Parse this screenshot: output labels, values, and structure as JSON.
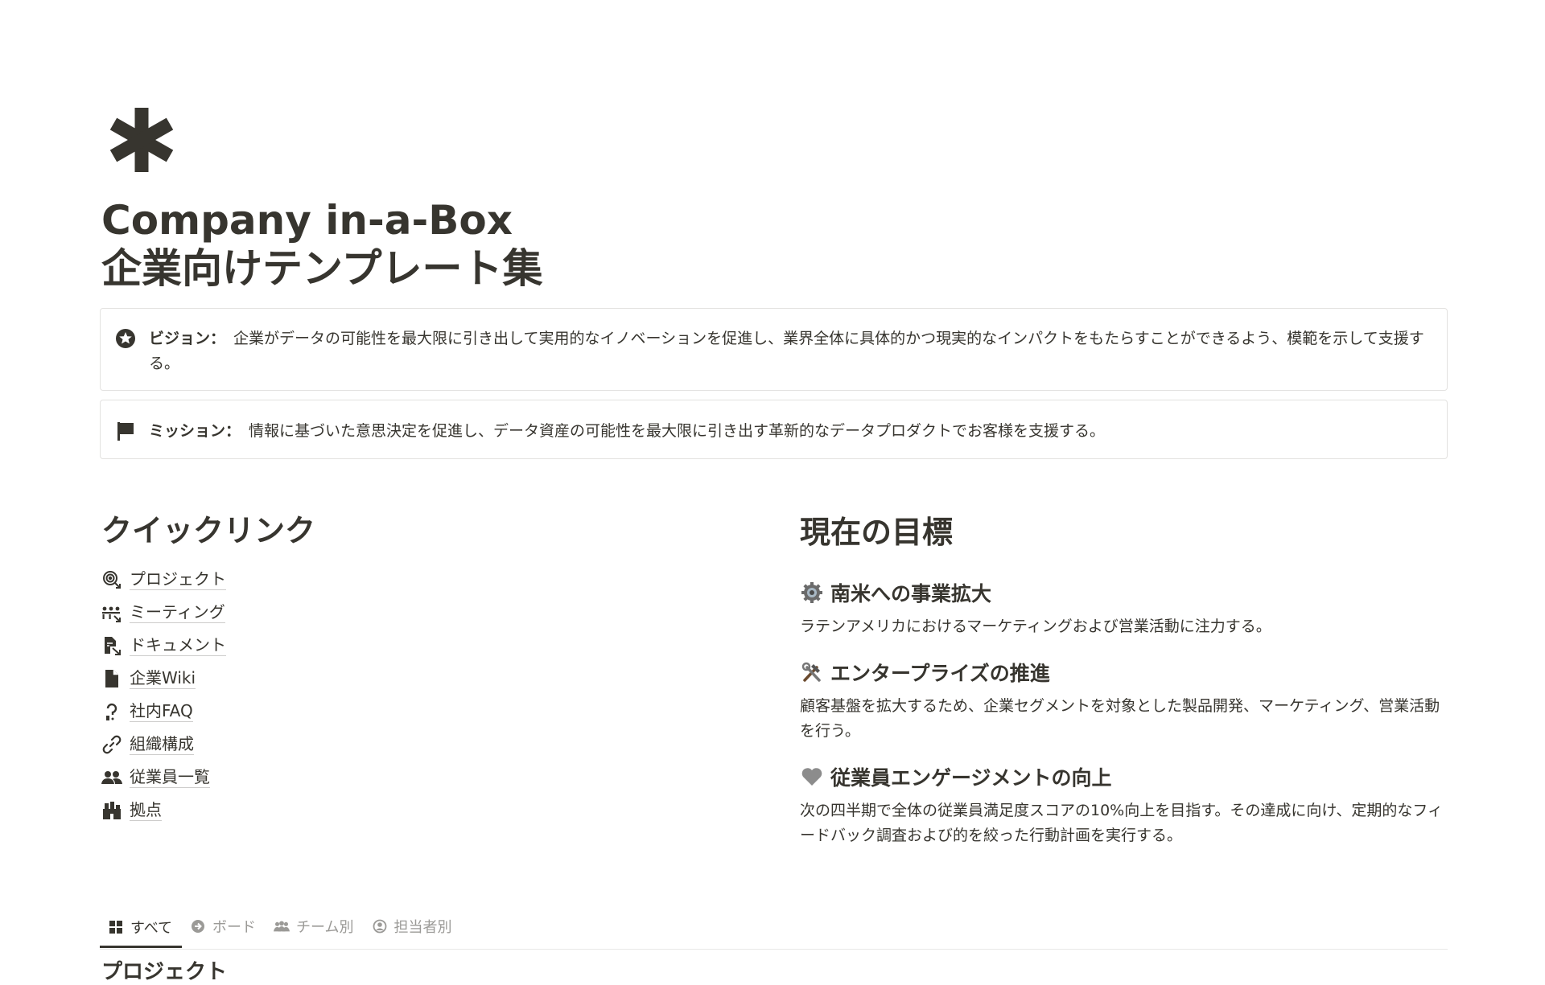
{
  "page": {
    "icon": "asterisk-icon",
    "title_line1": "Company in-a-Box",
    "title_line2": "企業向けテンプレート集"
  },
  "callouts": {
    "vision": {
      "icon": "star-circle-icon",
      "label": "ビジョン：",
      "text": "企業がデータの可能性を最大限に引き出して実用的なイノベーションを促進し、業界全体に具体的かつ現実的なインパクトをもたらすことができるよう、模範を示して支援する。"
    },
    "mission": {
      "icon": "flag-icon",
      "label": "ミッション：",
      "text": "情報に基づいた意思決定を促進し、データ資産の可能性を最大限に引き出す革新的なデータプロダクトでお客様を支援する。"
    }
  },
  "quick_links": {
    "title": "クイックリンク",
    "items": [
      {
        "label": "プロジェクト",
        "icon": "target-arrow-icon"
      },
      {
        "label": "ミーティング",
        "icon": "meeting-arrow-icon"
      },
      {
        "label": "ドキュメント",
        "icon": "document-arrow-icon"
      },
      {
        "label": "企業Wiki",
        "icon": "page-icon"
      },
      {
        "label": "社内FAQ",
        "icon": "question-icon"
      },
      {
        "label": "組織構成",
        "icon": "link-icon"
      },
      {
        "label": "従業員一覧",
        "icon": "people-icon"
      },
      {
        "label": "拠点",
        "icon": "building-icon"
      }
    ]
  },
  "goals": {
    "title": "現在の目標",
    "items": [
      {
        "emoji": "gear-emoji-icon",
        "title": "南米への事業拡大",
        "desc": "ラテンアメリカにおけるマーケティングおよび営業活動に注力する。"
      },
      {
        "emoji": "tools-emoji-icon",
        "title": "エンタープライズの推進",
        "desc": "顧客基盤を拡大するため、企業セグメントを対象とした製品開発、マーケティング、営業活動を行う。"
      },
      {
        "emoji": "grey-heart-icon",
        "title": "従業員エンゲージメントの向上",
        "desc": "次の四半期で全体の従業員満足度スコアの10%向上を目指す。その達成に向け、定期的なフィードバック調査および的を絞った行動計画を実行する。"
      }
    ]
  },
  "view_tabs": [
    {
      "label": "すべて",
      "icon": "grid-icon",
      "active": true
    },
    {
      "label": "ボード",
      "icon": "arrow-circle-icon",
      "active": false
    },
    {
      "label": "チーム別",
      "icon": "people-icon",
      "active": false
    },
    {
      "label": "担当者別",
      "icon": "user-circle-icon",
      "active": false
    }
  ],
  "database_title_partial": "プロジェクト"
}
